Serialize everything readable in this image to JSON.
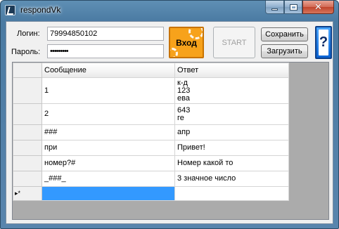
{
  "window": {
    "title": "respondVk",
    "controls": {
      "minimize": "",
      "maximize": "",
      "close": "✕"
    }
  },
  "form": {
    "login_label": "Логин:",
    "login_value": "79994850102",
    "password_label": "Пароль:",
    "password_value": "•••••••••",
    "login_button": "Вход",
    "start_button": "START",
    "save_button": "Сохранить",
    "load_button": "Загрузить",
    "help_button": "?"
  },
  "grid": {
    "columns": [
      "Сообщение",
      "Ответ"
    ],
    "rows": [
      {
        "message": "1",
        "answer": "к-д\n123\nева"
      },
      {
        "message": "2",
        "answer": "643\nге"
      },
      {
        "message": "###",
        "answer": "апр"
      },
      {
        "message": "при",
        "answer": "Привет!"
      },
      {
        "message": "номер?#",
        "answer": "Номер какой то"
      },
      {
        "message": "_###_",
        "answer": "3 значное число"
      },
      {
        "message": "",
        "answer": ""
      }
    ],
    "new_row_marker": "▸*"
  },
  "colors": {
    "title_bar": "#5985ad",
    "login_button": "#f7a21b",
    "selection": "#3399ff",
    "help_button": "#0a63d4"
  }
}
